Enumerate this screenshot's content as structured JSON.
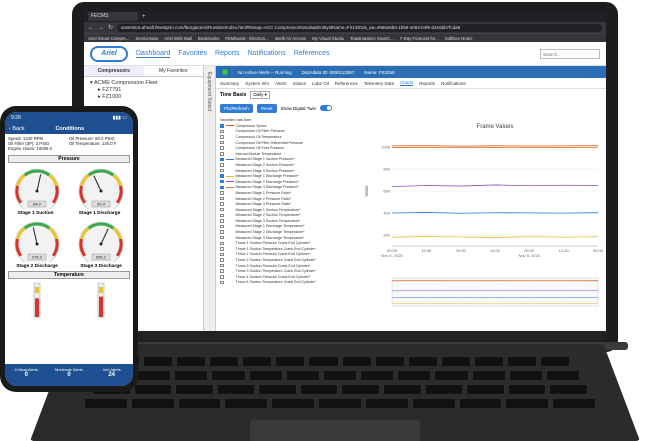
{
  "browser": {
    "tab_title": "FECMS",
    "url": "assetintra.ahsoft.fleetsprm.com/ftengaceris/Runtime/Index.html#Nmap=ACC.CompressorDetails&/EntityIdName=FXCD016_aa=4966e5b0-1b58-4063-b4f6-d4e5bb7fcda8",
    "bookmarks": [
      "Ariel Smart Compre...",
      "ServiceNow",
      "Ariel Web Mail",
      "Bookmarks",
      "FEMboard - Electrun...",
      "Intelli-Air Access",
      "My Visual Studio",
      "Toastmasters SmarC...",
      "7-Day Forecast for...",
      "SoftDev Notes"
    ]
  },
  "app": {
    "logo_text": "Ariel",
    "nav": [
      "Dashboard",
      "Favorites",
      "Reports",
      "Notifications",
      "References"
    ],
    "search_placeholder": "Search..."
  },
  "sidebar": {
    "tabs": [
      "Compressors",
      "My Favorites"
    ],
    "tree": [
      "ACME Compression Fleet",
      "FZ7791",
      "FZ1000"
    ],
    "equipment_label": "Equipment Select"
  },
  "status": {
    "alerts": "No Active Alerts -- Running",
    "unit_id_label": "DistAdata ID: 0000112087",
    "name_label": "Name: FS3255"
  },
  "subtabs": [
    "Summary",
    "System Info",
    "Alerts",
    "Values",
    "Lube Oil",
    "References",
    "Telemetry Data",
    "Charts",
    "Reports",
    "Notifications"
  ],
  "active_subtab": "Charts",
  "toolbar": {
    "time_basis_label": "Time Basis",
    "time_basis_value": "Daily",
    "plot_button": "Plot/Refresh",
    "reset_button": "Reset",
    "digital_twin_label": "Show Digital Twin",
    "list_heading": "Variables has form"
  },
  "variables": [
    {
      "label": "Compressor Speed",
      "checked": true,
      "color": "#e05a2b"
    },
    {
      "label": "Compressor Oil Filter Pressure",
      "checked": false,
      "color": ""
    },
    {
      "label": "Compressor Oil Temperature",
      "checked": false,
      "color": ""
    },
    {
      "label": "Compressor Oil Filter Differential Pressure",
      "checked": false,
      "color": ""
    },
    {
      "label": "Compressor Oil Flow Pressure",
      "checked": false,
      "color": ""
    },
    {
      "label": "Internal Module Temperature",
      "checked": false,
      "color": ""
    },
    {
      "label": "Measured Stage 1 Suction Pressure*",
      "checked": true,
      "color": "#2f7bd5"
    },
    {
      "label": "Measured Stage 2 Suction Pressure*",
      "checked": false,
      "color": ""
    },
    {
      "label": "Measured Stage 3 Suction Pressure*",
      "checked": false,
      "color": ""
    },
    {
      "label": "Measured Stage 1 Discharge Pressure*",
      "checked": true,
      "color": "#e2c02a"
    },
    {
      "label": "Measured Stage 2 Discharge Pressure*",
      "checked": true,
      "color": "#8a4fc7"
    },
    {
      "label": "Measured Stage 3 Discharge Pressure*",
      "checked": true,
      "color": "#e07a2b"
    },
    {
      "label": "Measured Stage 1 Pressure Ratio*",
      "checked": false,
      "color": ""
    },
    {
      "label": "Measured Stage 2 Pressure Ratio*",
      "checked": false,
      "color": ""
    },
    {
      "label": "Measured Stage 3 Pressure Ratio*",
      "checked": false,
      "color": ""
    },
    {
      "label": "Measured Stage 1 Suction Temperature*",
      "checked": false,
      "color": ""
    },
    {
      "label": "Measured Stage 2 Suction Temperature*",
      "checked": false,
      "color": ""
    },
    {
      "label": "Measured Stage 3 Suction Temperature*",
      "checked": false,
      "color": ""
    },
    {
      "label": "Measured Stage 1 Discharge Temperature*",
      "checked": false,
      "color": ""
    },
    {
      "label": "Measured Stage 2 Discharge Temperature*",
      "checked": false,
      "color": ""
    },
    {
      "label": "Measured Stage 3 Discharge Temperature*",
      "checked": false,
      "color": ""
    },
    {
      "label": "Throw 1 Suction Pressure Crank End Cylinder*",
      "checked": false,
      "color": ""
    },
    {
      "label": "Throw 1 Suction Temperature Crank End Cylinder*",
      "checked": false,
      "color": ""
    },
    {
      "label": "Throw 2 Suction Pressure Crank End Cylinder*",
      "checked": false,
      "color": ""
    },
    {
      "label": "Throw 2 Suction Temperature Crank End Cylinder*",
      "checked": false,
      "color": ""
    },
    {
      "label": "Throw 3 Suction Pressure Crank End Cylinder*",
      "checked": false,
      "color": ""
    },
    {
      "label": "Throw 3 Suction Temperature Crank End Cylinder*",
      "checked": false,
      "color": ""
    },
    {
      "label": "Throw 4 Suction Pressure Crank End Cylinder*",
      "checked": false,
      "color": ""
    },
    {
      "label": "Throw 4 Suction Temperature Crank End Cylinder*",
      "checked": false,
      "color": ""
    }
  ],
  "chart_data": {
    "type": "line",
    "title": "Frame Values",
    "ylabel": "Value",
    "x": [
      "00:00\nNov 4, 2020",
      "12:00",
      "00:00",
      "12:00",
      "00:00\nNov 5, 2020",
      "12:00",
      "00:00"
    ],
    "yticks": [
      200,
      400,
      600,
      800,
      1000
    ],
    "ylim": [
      100,
      1100
    ],
    "series": [
      {
        "color": "#e05a2b",
        "values": [
          1010,
          1012,
          1008,
          1011,
          1009,
          1010,
          1012
        ]
      },
      {
        "color": "#e07a2b",
        "values": [
          995,
          996,
          994,
          995,
          996,
          995,
          994
        ]
      },
      {
        "color": "#8a4fc7",
        "values": [
          640,
          650,
          645,
          655,
          648,
          652,
          650
        ]
      },
      {
        "color": "#2f7bd5",
        "values": [
          400,
          405,
          398,
          402,
          401,
          399,
          403
        ]
      },
      {
        "color": "#e2c02a",
        "values": [
          180,
          185,
          182,
          178,
          184,
          181,
          183
        ]
      }
    ]
  },
  "phone": {
    "time": "9:28",
    "back_label": "Back",
    "title": "Conditions",
    "info": [
      "Speed: 1340 RPM",
      "Oil Pressure: 69.2 PSIG",
      "Oil Filter (dP): 3 PSID",
      "Oil Temperature: 136.0 F",
      "Engine Hours: 16006.0",
      ""
    ],
    "sections": [
      "Pressure",
      "Stage 1 Suction",
      "Stage 1 Discharge",
      "Stage 2 Discharge",
      "Stage 3 Discharge",
      "Temperature"
    ],
    "gauges": [
      {
        "value": 0.55,
        "readout": "84.0"
      },
      {
        "value": 0.4,
        "readout": "50.4"
      },
      {
        "value": 0.45,
        "readout": "276.3"
      },
      {
        "value": 0.6,
        "readout": "656.2"
      }
    ],
    "thermos": [
      {
        "level": 0.55
      },
      {
        "level": 0.6
      }
    ],
    "bottom": [
      {
        "label": "Critical Alerts",
        "value": "0"
      },
      {
        "label": "Moderate Alerts",
        "value": "0"
      },
      {
        "label": "Info Alerts",
        "value": "24"
      }
    ]
  }
}
